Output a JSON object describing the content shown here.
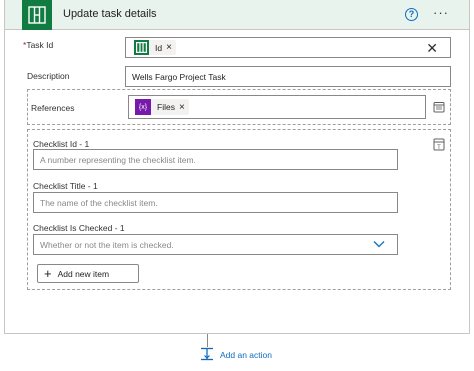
{
  "header": {
    "title": "Update task details",
    "help_glyph": "?",
    "more_glyph": "···",
    "app_icon": "planner-icon",
    "accent_color": "#107c41",
    "header_bg": "#e8f3ed"
  },
  "fields": {
    "task_id": {
      "required_mark": "*",
      "label": "Task Id",
      "token_label": "Id",
      "token_icon": "planner-icon",
      "token_color": "#107c41",
      "token_remove": "×",
      "clear_glyph": "✕"
    },
    "description": {
      "label": "Description",
      "value": "Wells Fargo Project Task"
    },
    "references": {
      "label": "References",
      "token_label": "Files",
      "token_icon": "expression-icon",
      "token_icon_text": "{x}",
      "token_color": "#7719aa",
      "token_remove": "×"
    }
  },
  "checklist": {
    "id": {
      "label": "Checklist Id - 1",
      "placeholder": "A number representing the checklist item."
    },
    "title": {
      "label": "Checklist Title - 1",
      "placeholder": "The name of the checklist item."
    },
    "is_checked": {
      "label": "Checklist Is Checked - 1",
      "placeholder": "Whether or not the item is checked."
    },
    "add_item_label": "Add new item"
  },
  "footer": {
    "add_action_label": "Add an action"
  }
}
